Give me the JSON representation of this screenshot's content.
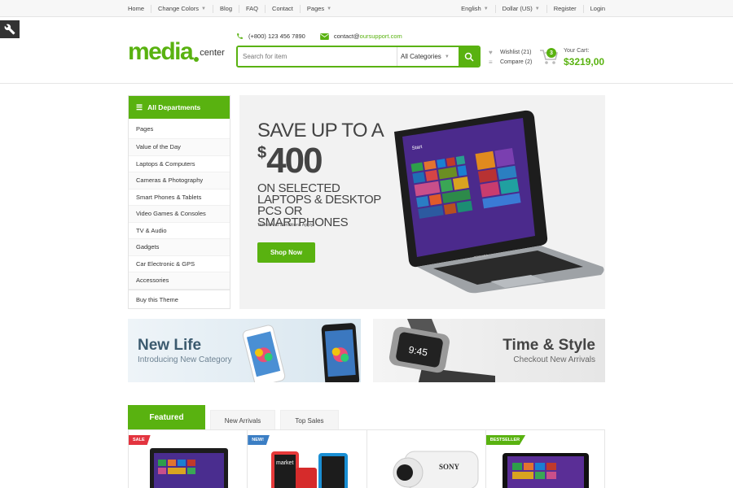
{
  "topbar": {
    "left": [
      "Home",
      "Change Colors",
      "Blog",
      "FAQ",
      "Contact",
      "Pages"
    ],
    "right": [
      "English",
      "Dollar (US)",
      "Register",
      "Login"
    ]
  },
  "logo": {
    "main": "media",
    "sub": "center"
  },
  "contact": {
    "phone": "(+800) 123 456 7890",
    "email_prefix": "contact@",
    "email_domain": "oursupport.com"
  },
  "search": {
    "placeholder": "Search for item",
    "category": "All Categories"
  },
  "wishlist": {
    "wishlist_label": "Wishlist (21)",
    "compare_label": "Compare (2)"
  },
  "cart": {
    "count": "3",
    "label": "Your Cart:",
    "total": "$3219,00"
  },
  "departments": {
    "title": "All Departments",
    "items": [
      "Pages",
      "Value of the Day",
      "Laptops & Computers",
      "Cameras & Photography",
      "Smart Phones & Tablets",
      "Video Games & Consoles",
      "TV & Audio",
      "Gadgets",
      "Car Electronic & GPS",
      "Accessories",
      "Buy this Theme"
    ]
  },
  "hero": {
    "line1": "SAVE UP TO A",
    "currency": "$",
    "amount": "400",
    "line3": "ON SELECTED LAPTOPS & DESKTOP PCS OR SMARTPHONES",
    "terms": "Terms And Conditions Apply",
    "button": "Shop Now",
    "screen_text": "Start",
    "brand": "TOSHIBA"
  },
  "banners": [
    {
      "title": "New Life",
      "subtitle": "Introducing New Category"
    },
    {
      "title": "Time & Style",
      "subtitle": "Checkout New Arrivals",
      "watch_time": "9:45"
    }
  ],
  "tabs": [
    "Featured",
    "New Arrivals",
    "Top Sales"
  ],
  "products": [
    {
      "badge": "SALE",
      "badge_color": "#e3343f"
    },
    {
      "badge": "NEW!",
      "badge_color": "#3b7ec4",
      "screen_text": "market"
    },
    {
      "badge": "",
      "badge_color": "",
      "brand": "SONY"
    },
    {
      "badge": "BESTSELLER",
      "badge_color": "#59b210"
    }
  ],
  "colors": {
    "accent": "#59b210",
    "sale": "#e3343f",
    "new": "#3b7ec4"
  }
}
